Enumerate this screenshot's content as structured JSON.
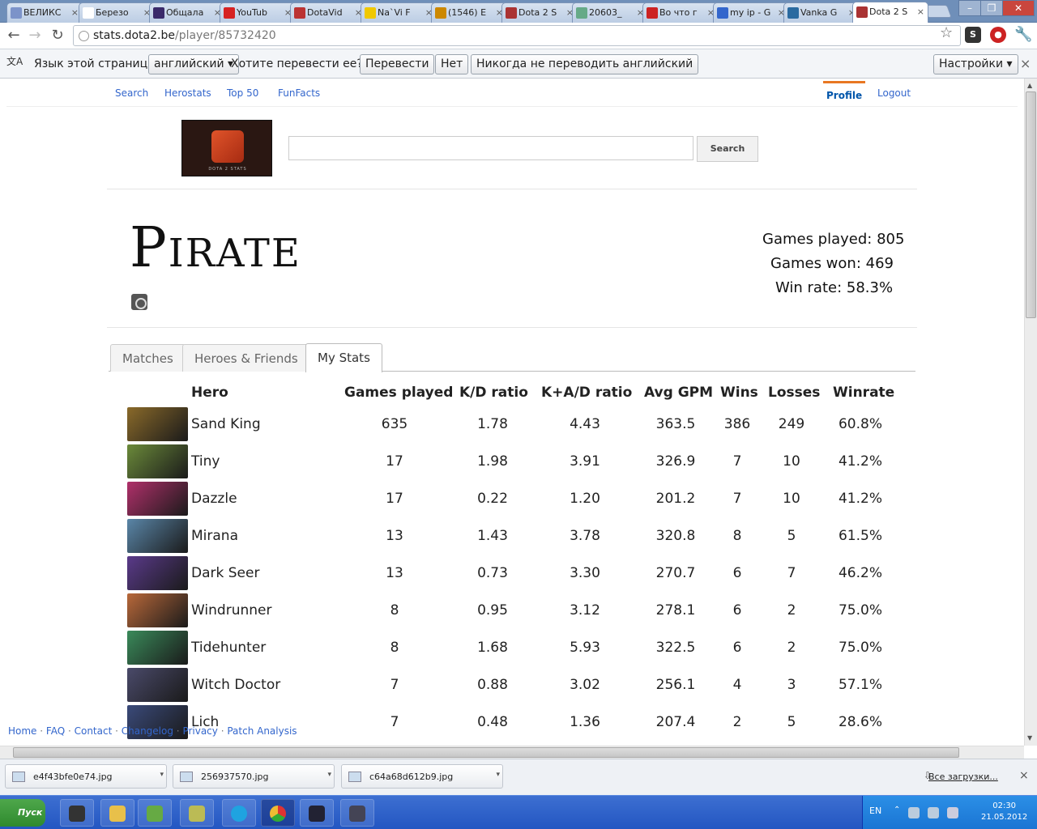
{
  "browser": {
    "tabs": [
      {
        "label": "ВЕЛИКС",
        "icon": "pd-icon",
        "color": "#7c93c9"
      },
      {
        "label": "Березо",
        "icon": "wikipedia-icon",
        "color": "#ffffff"
      },
      {
        "label": "Общала",
        "icon": "forum-icon",
        "color": "#3a2a6a"
      },
      {
        "label": "YouTub",
        "icon": "youtube-icon",
        "color": "#d62222"
      },
      {
        "label": "DotaVid",
        "icon": "dota-icon",
        "color": "#b33"
      },
      {
        "label": "Na`Vi F",
        "icon": "navi-icon",
        "color": "#f0c800"
      },
      {
        "label": "(1546) E",
        "icon": "clock-icon",
        "color": "#c80"
      },
      {
        "label": "Dota 2 S",
        "icon": "dota-icon",
        "color": "#a33"
      },
      {
        "label": "20603_",
        "icon": "image-icon",
        "color": "#6a8"
      },
      {
        "label": "Во что г",
        "icon": "game-icon",
        "color": "#c22"
      },
      {
        "label": "my ip - G",
        "icon": "google-icon",
        "color": "#36c"
      },
      {
        "label": "Vanka G",
        "icon": "channel-icon",
        "color": "#2a6aa0"
      },
      {
        "label": "Dota 2 S",
        "icon": "dota-icon",
        "color": "#a33"
      }
    ],
    "url_host": "stats.dota2.be",
    "url_path": "/player/85732420"
  },
  "infobar": {
    "prompt": "Язык этой страницы",
    "language": "английский",
    "question": "Хотите перевести ее?",
    "translate": "Перевести",
    "no": "Нет",
    "never": "Никогда не переводить английский",
    "settings": "Настройки"
  },
  "nav": {
    "search": "Search",
    "herostats": "Herostats",
    "top50": "Top 50",
    "funfacts": "FunFacts",
    "profile": "Profile",
    "logout": "Logout"
  },
  "header": {
    "search_button": "Search",
    "logo_caption": "DOTA 2 STATS"
  },
  "player": {
    "name": "Pirate",
    "games_played": "Games played: 805",
    "games_won": "Games won: 469",
    "win_rate": "Win rate: 58.3%"
  },
  "tabs": {
    "matches": "Matches",
    "heroes_friends": "Heroes & Friends",
    "my_stats": "My Stats"
  },
  "table": {
    "headers": [
      "Hero",
      "Games played",
      "K/D ratio",
      "K+A/D ratio",
      "Avg GPM",
      "Wins",
      "Losses",
      "Winrate"
    ],
    "rows": [
      {
        "hero": "Sand King",
        "games": "635",
        "kd": "1.78",
        "kad": "4.43",
        "gpm": "363.5",
        "wins": "386",
        "losses": "249",
        "winrate": "60.8%",
        "color": "#8a6a2a"
      },
      {
        "hero": "Tiny",
        "games": "17",
        "kd": "1.98",
        "kad": "3.91",
        "gpm": "326.9",
        "wins": "7",
        "losses": "10",
        "winrate": "41.2%",
        "color": "#6b8a3a"
      },
      {
        "hero": "Dazzle",
        "games": "17",
        "kd": "0.22",
        "kad": "1.20",
        "gpm": "201.2",
        "wins": "7",
        "losses": "10",
        "winrate": "41.2%",
        "color": "#b0306a"
      },
      {
        "hero": "Mirana",
        "games": "13",
        "kd": "1.43",
        "kad": "3.78",
        "gpm": "320.8",
        "wins": "8",
        "losses": "5",
        "winrate": "61.5%",
        "color": "#5a86a8"
      },
      {
        "hero": "Dark Seer",
        "games": "13",
        "kd": "0.73",
        "kad": "3.30",
        "gpm": "270.7",
        "wins": "6",
        "losses": "7",
        "winrate": "46.2%",
        "color": "#5a3a8a"
      },
      {
        "hero": "Windrunner",
        "games": "8",
        "kd": "0.95",
        "kad": "3.12",
        "gpm": "278.1",
        "wins": "6",
        "losses": "2",
        "winrate": "75.0%",
        "color": "#b8683a"
      },
      {
        "hero": "Tidehunter",
        "games": "8",
        "kd": "1.68",
        "kad": "5.93",
        "gpm": "322.5",
        "wins": "6",
        "losses": "2",
        "winrate": "75.0%",
        "color": "#3a8a5a"
      },
      {
        "hero": "Witch Doctor",
        "games": "7",
        "kd": "0.88",
        "kad": "3.02",
        "gpm": "256.1",
        "wins": "4",
        "losses": "3",
        "winrate": "57.1%",
        "color": "#4a4a6a"
      },
      {
        "hero": "Lich",
        "games": "7",
        "kd": "0.48",
        "kad": "1.36",
        "gpm": "207.4",
        "wins": "2",
        "losses": "5",
        "winrate": "28.6%",
        "color": "#3a4a7a"
      }
    ]
  },
  "footer": {
    "home": "Home",
    "faq": "FAQ",
    "contact": "Contact",
    "changelog": "Changelog",
    "privacy": "Privacy",
    "patch": "Patch Analysis"
  },
  "downloads": {
    "items": [
      "e4f43bfe0e74.jpg",
      "256937570.jpg",
      "c64a68d612b9.jpg"
    ],
    "all": "Все загрузки..."
  },
  "taskbar": {
    "start": "Пуск",
    "lang": "EN",
    "time": "02:30",
    "date": "21.05.2012"
  }
}
